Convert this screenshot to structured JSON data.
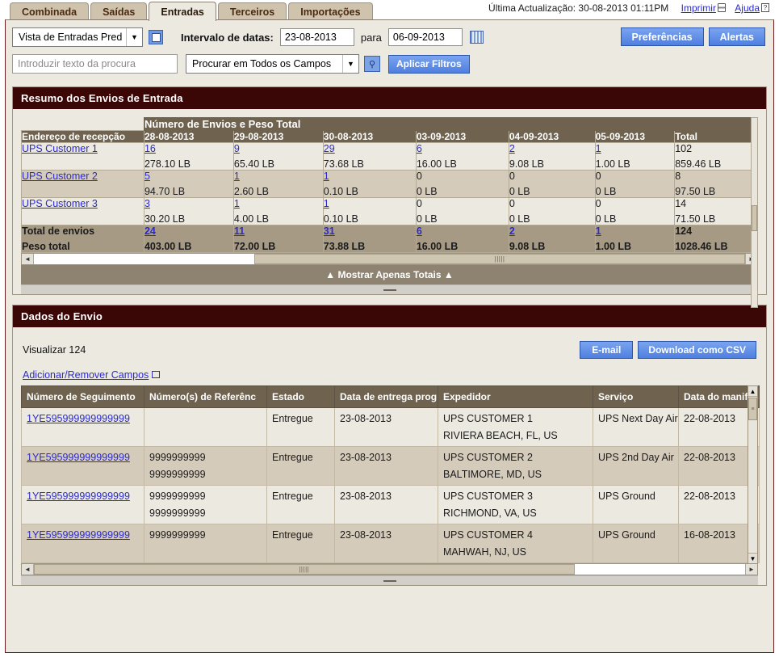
{
  "tabs": [
    {
      "label": "Combinada",
      "active": false
    },
    {
      "label": "Saídas",
      "active": false
    },
    {
      "label": "Entradas",
      "active": true
    },
    {
      "label": "Terceiros",
      "active": false
    },
    {
      "label": "Importações",
      "active": false
    }
  ],
  "header": {
    "last_update": "Última Actualização: 30-08-2013 01:11PM",
    "print_label": "Imprimir",
    "help_label": "Ajuda"
  },
  "filters": {
    "view_select": "Vista de Entradas Pred",
    "date_range_label": "Intervalo de datas:",
    "date_from": "23-08-2013",
    "between_label": "para",
    "date_to": "06-09-2013",
    "search_placeholder": "Introduzir texto da procura",
    "search_value": "",
    "field_select": "Procurar em Todos os Campos",
    "apply_label": "Aplicar Filtros",
    "preferences_label": "Preferências",
    "alerts_label": "Alertas"
  },
  "summary": {
    "panel_title": "Resumo dos Envios de Entrada",
    "super_header": "Número de Envios e Peso Total",
    "first_col_header": "Endereço de recepção",
    "date_columns": [
      "28-08-2013",
      "29-08-2013",
      "30-08-2013",
      "03-09-2013",
      "04-09-2013",
      "05-09-2013"
    ],
    "total_column": "Total",
    "rows": [
      {
        "name": "UPS Customer 1",
        "counts": [
          "16",
          "9",
          "29",
          "6",
          "2",
          "1"
        ],
        "weights": [
          "278.10 LB",
          "65.40 LB",
          "73.68 LB",
          "16.00 LB",
          "9.08 LB",
          "1.00 LB"
        ],
        "total_count": "102",
        "total_weight": "859.46 LB",
        "linked": [
          true,
          true,
          true,
          true,
          true,
          true
        ]
      },
      {
        "name": "UPS Customer 2",
        "counts": [
          "5",
          "1",
          "1",
          "0",
          "0",
          "0"
        ],
        "weights": [
          "94.70 LB",
          "2.60 LB",
          "0.10 LB",
          "0 LB",
          "0 LB",
          "0 LB"
        ],
        "total_count": "8",
        "total_weight": "97.50 LB",
        "linked": [
          true,
          true,
          true,
          false,
          false,
          false
        ]
      },
      {
        "name": "UPS Customer 3",
        "counts": [
          "3",
          "1",
          "1",
          "0",
          "0",
          "0"
        ],
        "weights": [
          "30.20 LB",
          "4.00 LB",
          "0.10 LB",
          "0 LB",
          "0 LB",
          "0 LB"
        ],
        "total_count": "14",
        "total_weight": "71.50 LB",
        "linked": [
          true,
          true,
          true,
          false,
          false,
          false
        ]
      }
    ],
    "total_row": {
      "label_line1": "Total de envios",
      "label_line2": "Peso total",
      "counts": [
        "24",
        "11",
        "31",
        "6",
        "2",
        "1"
      ],
      "weights": [
        "403.00 LB",
        "72.00 LB",
        "73.88 LB",
        "16.00 LB",
        "9.08 LB",
        "1.00 LB"
      ],
      "total_count": "124",
      "total_weight": "1028.46 LB"
    },
    "show_totals_label": "▲  Mostrar Apenas Totais  ▲"
  },
  "shipment": {
    "panel_title": "Dados do Envio",
    "view_count_label": "Visualizar 124",
    "email_label": "E-mail",
    "csv_label": "Download como CSV",
    "add_remove_label": "Adicionar/Remover Campos",
    "columns": [
      "Número de Seguimento",
      "Número(s) de Referênc",
      "Estado",
      "Data de entrega prog",
      "Expedidor",
      "Serviço",
      "Data do manifes"
    ],
    "rows": [
      {
        "tracking": "1YE595999999999999",
        "reference1": "",
        "reference2": "",
        "status": "Entregue",
        "delivery_date": "23-08-2013",
        "shipper": "UPS CUSTOMER 1",
        "shipper_location": "RIVIERA BEACH, FL, US",
        "service": "UPS Next Day Air",
        "manifest_date": "22-08-2013"
      },
      {
        "tracking": "1YE595999999999999",
        "reference1": "9999999999",
        "reference2": "9999999999",
        "status": "Entregue",
        "delivery_date": "23-08-2013",
        "shipper": "UPS CUSTOMER 2",
        "shipper_location": "BALTIMORE, MD, US",
        "service": "UPS 2nd Day Air",
        "manifest_date": "22-08-2013"
      },
      {
        "tracking": "1YE595999999999999",
        "reference1": "9999999999",
        "reference2": "9999999999",
        "status": "Entregue",
        "delivery_date": "23-08-2013",
        "shipper": "UPS CUSTOMER 3",
        "shipper_location": "RICHMOND, VA, US",
        "service": "UPS Ground",
        "manifest_date": "22-08-2013"
      },
      {
        "tracking": "1YE595999999999999",
        "reference1": "9999999999",
        "reference2": "",
        "status": "Entregue",
        "delivery_date": "23-08-2013",
        "shipper": "UPS CUSTOMER 4",
        "shipper_location": "MAHWAH, NJ, US",
        "service": "UPS Ground",
        "manifest_date": "16-08-2013"
      }
    ]
  },
  "colors": {
    "panel_header": "#3b0606",
    "table_header": "#6f6350",
    "page_bg": "#ece9e1",
    "row_alt": "#d5cbba",
    "total_row": "#a79a85",
    "link": "#2a2ad0",
    "button_blue": "#4f7fe0"
  }
}
